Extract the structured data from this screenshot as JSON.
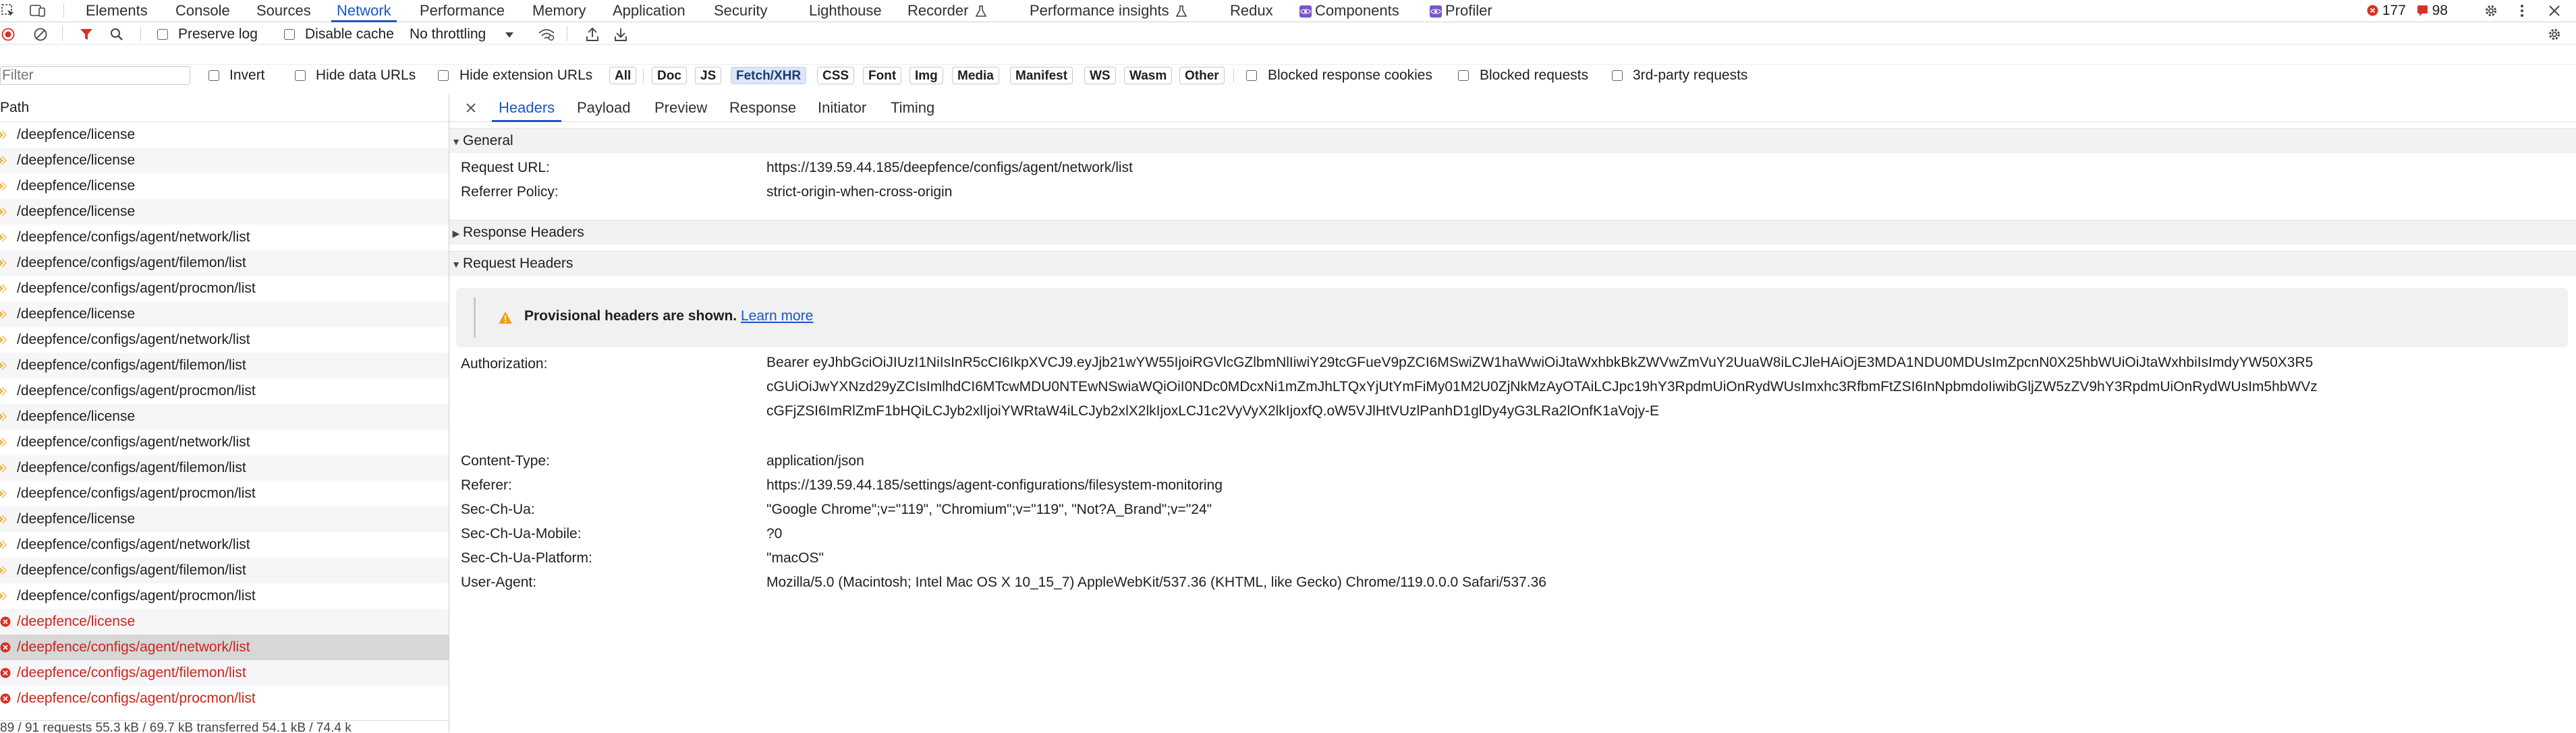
{
  "devtools_tabs": [
    {
      "label": "Elements"
    },
    {
      "label": "Console"
    },
    {
      "label": "Sources"
    },
    {
      "label": "Network"
    },
    {
      "label": "Performance"
    },
    {
      "label": "Memory"
    },
    {
      "label": "Application"
    },
    {
      "label": "Security"
    },
    {
      "label": "Lighthouse"
    },
    {
      "label": "Recorder"
    },
    {
      "label": "Performance insights"
    },
    {
      "label": "Redux"
    },
    {
      "label": "Components"
    },
    {
      "label": "Profiler"
    }
  ],
  "active_tab": "Network",
  "badges": {
    "errors": "177",
    "warnings": "98"
  },
  "toolbar": {
    "preserve_log": "Preserve log",
    "disable_cache": "Disable cache",
    "throttling": "No throttling"
  },
  "filter_bar": {
    "placeholder": "Filter",
    "invert": "Invert",
    "hide_data_urls": "Hide data URLs",
    "hide_extension_urls": "Hide extension URLs",
    "types": [
      "All",
      "Doc",
      "JS",
      "Fetch/XHR",
      "CSS",
      "Font",
      "Img",
      "Media",
      "Manifest",
      "WS",
      "Wasm",
      "Other"
    ],
    "active_type": "Fetch/XHR",
    "blocked_response_cookies": "Blocked response cookies",
    "blocked_requests": "Blocked requests",
    "third_party": "3rd-party requests"
  },
  "request_list": {
    "header": "Path",
    "rows": [
      {
        "path": "/deepfence/license",
        "error": false
      },
      {
        "path": "/deepfence/license",
        "error": false
      },
      {
        "path": "/deepfence/license",
        "error": false
      },
      {
        "path": "/deepfence/license",
        "error": false
      },
      {
        "path": "/deepfence/configs/agent/network/list",
        "error": false
      },
      {
        "path": "/deepfence/configs/agent/filemon/list",
        "error": false
      },
      {
        "path": "/deepfence/configs/agent/procmon/list",
        "error": false
      },
      {
        "path": "/deepfence/license",
        "error": false
      },
      {
        "path": "/deepfence/configs/agent/network/list",
        "error": false
      },
      {
        "path": "/deepfence/configs/agent/filemon/list",
        "error": false
      },
      {
        "path": "/deepfence/configs/agent/procmon/list",
        "error": false
      },
      {
        "path": "/deepfence/license",
        "error": false
      },
      {
        "path": "/deepfence/configs/agent/network/list",
        "error": false
      },
      {
        "path": "/deepfence/configs/agent/filemon/list",
        "error": false
      },
      {
        "path": "/deepfence/configs/agent/procmon/list",
        "error": false
      },
      {
        "path": "/deepfence/license",
        "error": false
      },
      {
        "path": "/deepfence/configs/agent/network/list",
        "error": false
      },
      {
        "path": "/deepfence/configs/agent/filemon/list",
        "error": false
      },
      {
        "path": "/deepfence/configs/agent/procmon/list",
        "error": false
      },
      {
        "path": "/deepfence/license",
        "error": true
      },
      {
        "path": "/deepfence/configs/agent/network/list",
        "error": true,
        "selected": true
      },
      {
        "path": "/deepfence/configs/agent/filemon/list",
        "error": true
      },
      {
        "path": "/deepfence/configs/agent/procmon/list",
        "error": true
      }
    ],
    "status": "89 / 91 requests   55.3 kB / 69.7 kB transferred   54.1 kB / 74.4 k"
  },
  "details": {
    "tabs": [
      "Headers",
      "Payload",
      "Preview",
      "Response",
      "Initiator",
      "Timing"
    ],
    "active": "Headers",
    "general_title": "General",
    "general": [
      {
        "key": "Request URL:",
        "value": "https://139.59.44.185/deepfence/configs/agent/network/list"
      },
      {
        "key": "Referrer Policy:",
        "value": "strict-origin-when-cross-origin"
      }
    ],
    "response_headers_title": "Response Headers",
    "request_headers_title": "Request Headers",
    "warning": {
      "text": "Provisional headers are shown.",
      "link": "Learn more"
    },
    "authorization": {
      "key": "Authorization:",
      "value": "Bearer eyJhbGciOiJIUzI1NiIsInR5cCI6IkpXVCJ9.eyJjb21wYW55IjoiRGVlcGZlbmNlIiwiY29tcGFueV9pZCI6MSwiZW1haWwiOiJtaWxhbkBkZWVwZmVuY2UuaW8iLCJleHAiOjE3MDA1NDU0MDUsImZpcnN0X25hbWUiOiJtaWxhbiIsImdyYW50X3R5cGUiOiJwYXNzd29yZCIsImlhdCI6MTcwMDU0NTEwNSwiaWQiOiI0NDc0MDcxNi1mZmJhLTQxYjUtYmFiMy01M2U0ZjNkMzAyOTAiLCJpc19hY3RpdmUiOnRydWUsImxhc3RfbmFtZSI6InNpbmdoIiwibGljZW5zZV9hY3RpdmUiOnRydWUsIm5hbWVzcGFjZSI6ImRlZmF1bHQiLCJyb2xlIjoiYWRtaW4iLCJyb2xlX2lkIjoxLCJ1c2VyVyX2lkIjoxfQ.oW5VJlHtVUzlPanhD1glDy4yG3LRa2lOnfK1aVojy-E"
    },
    "request_headers": [
      {
        "key": "Content-Type:",
        "value": "application/json"
      },
      {
        "key": "Referer:",
        "value": "https://139.59.44.185/settings/agent-configurations/filesystem-monitoring"
      },
      {
        "key": "Sec-Ch-Ua:",
        "value": "\"Google Chrome\";v=\"119\", \"Chromium\";v=\"119\", \"Not?A_Brand\";v=\"24\""
      },
      {
        "key": "Sec-Ch-Ua-Mobile:",
        "value": "?0"
      },
      {
        "key": "Sec-Ch-Ua-Platform:",
        "value": "\"macOS\""
      },
      {
        "key": "User-Agent:",
        "value": "Mozilla/5.0 (Macintosh; Intel Mac OS X 10_15_7) AppleWebKit/537.36 (KHTML, like Gecko) Chrome/119.0.0.0 Safari/537.36"
      }
    ]
  },
  "colors": {
    "accent": "#1a56c4",
    "error": "#c9251c",
    "selected_row": "#d7d7d7",
    "chip_active": "#dbe6f7"
  }
}
